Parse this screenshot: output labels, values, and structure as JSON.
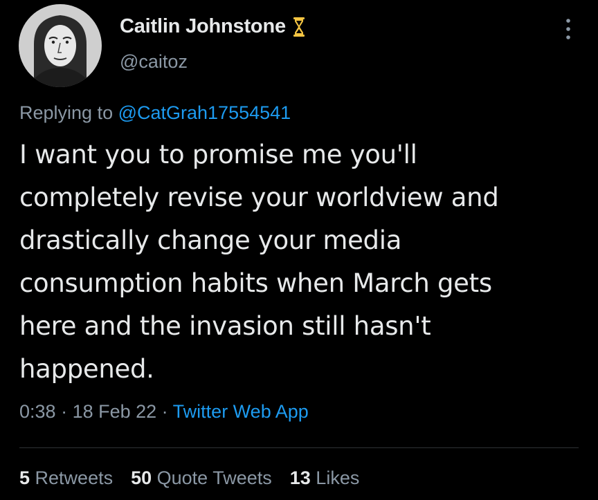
{
  "author": {
    "display_name": "Caitlin Johnstone",
    "handle": "@caitoz",
    "badge_icon": "hourglass-icon"
  },
  "reply": {
    "prefix": "Replying to ",
    "mention": "@CatGrah17554541"
  },
  "tweet": {
    "text": "I want you to promise me you'll\ncompletely revise your worldview and\ndrastically change your media\nconsumption habits when March gets\nhere and the invasion still hasn't\nhappened."
  },
  "meta": {
    "time": "0:38",
    "sep1": " · ",
    "date": "18 Feb 22",
    "sep2": " · ",
    "source": "Twitter Web App"
  },
  "stats": {
    "retweets_count": "5",
    "retweets_label": " Retweets",
    "quotes_count": "50",
    "quotes_label": " Quote Tweets",
    "likes_count": "13",
    "likes_label": " Likes"
  },
  "colors": {
    "background": "#000000",
    "primary_text": "#e7e9ea",
    "secondary_text": "#8b98a5",
    "link": "#1d9bf0",
    "hourglass": "#f5c542"
  }
}
